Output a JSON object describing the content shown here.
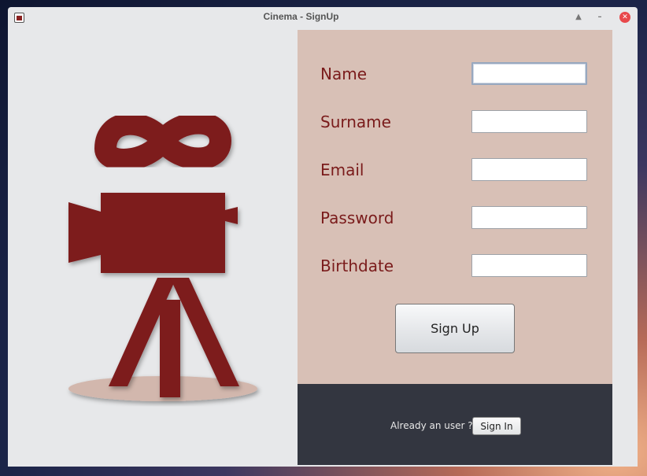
{
  "window": {
    "title": "Cinema - SignUp"
  },
  "form": {
    "fields": [
      {
        "label": "Name",
        "value": ""
      },
      {
        "label": "Surname",
        "value": ""
      },
      {
        "label": "Email",
        "value": ""
      },
      {
        "label": "Password",
        "value": ""
      },
      {
        "label": "Birthdate",
        "value": ""
      }
    ],
    "signup_label": "Sign Up"
  },
  "footer": {
    "prompt": "Already an user ?",
    "signin_label": "Sign In"
  },
  "colors": {
    "accent": "#7d1a1d",
    "form_background": "#d8c0b6",
    "footer_background": "#333640"
  },
  "icons": [
    "app-icon",
    "maximize-icon",
    "minimize-icon",
    "close-icon",
    "cinema-camera-logo"
  ]
}
